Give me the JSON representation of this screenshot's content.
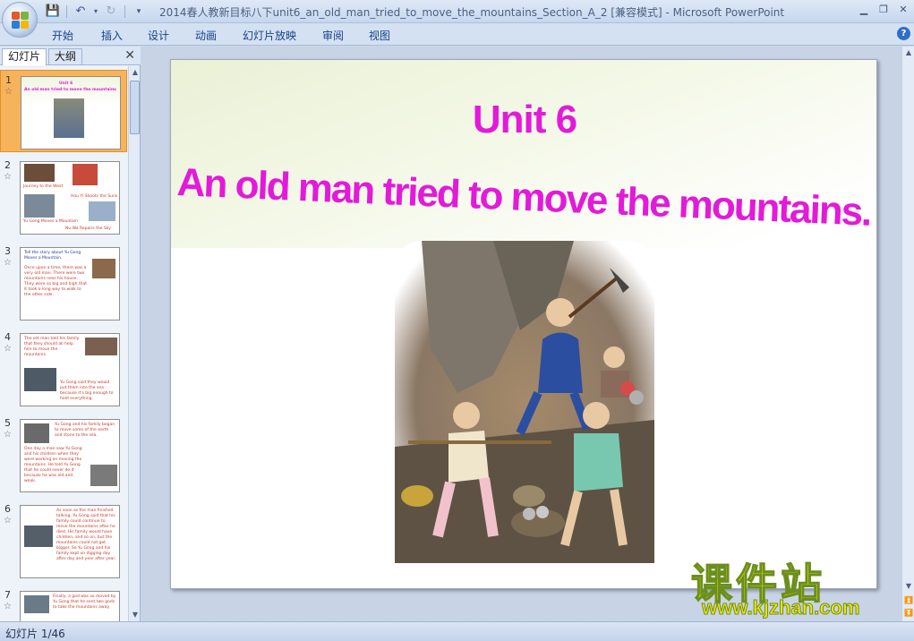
{
  "window": {
    "title": "2014春人教新目标八下unit6_an_old_man_tried_to_move_the_mountains_Section_A_2 [兼容模式] - Microsoft PowerPoint"
  },
  "ribbon": {
    "tabs": [
      "开始",
      "插入",
      "设计",
      "动画",
      "幻灯片放映",
      "审阅",
      "视图"
    ]
  },
  "left_pane": {
    "tabs": [
      "幻灯片",
      "大纲"
    ],
    "close": "✕",
    "thumbnails": [
      {
        "num": "1",
        "lines": [
          "Unit 6",
          "An old man tried to move the mountains"
        ]
      },
      {
        "num": "2",
        "lines": [
          "Journey to the West",
          "Hou Yi Shoots the Suns",
          "Yu Gong Moves a Mountain",
          "Nu Wa Repairs the Sky"
        ]
      },
      {
        "num": "3",
        "lines": [
          "Tell the story about Yu Gong Moves a Mountain.",
          "Once upon a time, there was a very old man. There were two mountains near his house. They were so big and high that it took a long way to walk to the other side."
        ]
      },
      {
        "num": "4",
        "lines": [
          "The old man told his family that they should all help him to move the mountains.",
          "Yu Gong said they would put them into the sea because it's big enough to hold everything."
        ]
      },
      {
        "num": "5",
        "lines": [
          "Yu Gong and his family began to move some of the earth and stone to the sea.",
          "One day a man saw Yu Gong and his children when they were working on moving the mountains. He told Yu Gong that he could never do it because he was old and weak."
        ]
      },
      {
        "num": "6",
        "lines": [
          "As soon as the man finished talking, Yu Gong said that his family could continue to move the mountains after he died. His family would have children, and so on, but the mountains could not get bigger. So Yu Gong and his family kept on digging day after day and year after year."
        ]
      },
      {
        "num": "7",
        "lines": [
          "Finally, a god was so moved by Yu Gong that he sent two gods to take the mountains away."
        ]
      }
    ]
  },
  "slide": {
    "title": "Unit 6",
    "subtitle": "An old man tried to move the mountains."
  },
  "watermark": {
    "brand": "课件站",
    "url": "www.kjzhan.com"
  },
  "status": {
    "slide_counter": "幻灯片 1/46"
  },
  "colors": {
    "title_magenta": "#e31ad9",
    "selected_thumb": "#f7b359"
  }
}
